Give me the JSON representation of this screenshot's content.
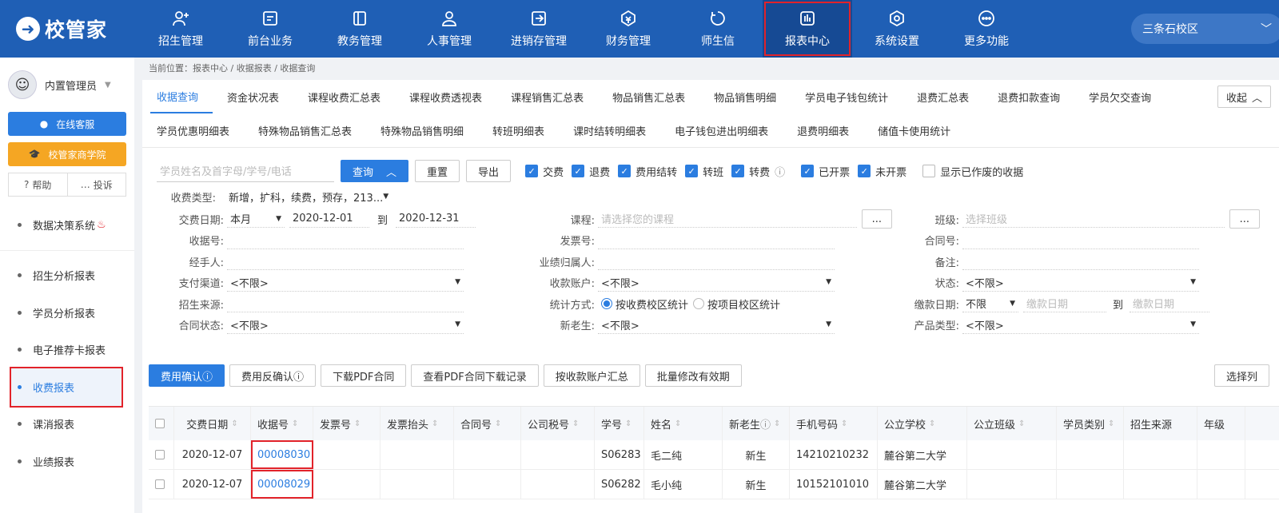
{
  "app": {
    "logo_text": "校管家"
  },
  "nav": [
    {
      "label": "招生管理",
      "icon": "user-plus-icon"
    },
    {
      "label": "前台业务",
      "icon": "desk-icon"
    },
    {
      "label": "教务管理",
      "icon": "book-icon"
    },
    {
      "label": "人事管理",
      "icon": "person-icon"
    },
    {
      "label": "进销存管理",
      "icon": "inventory-icon"
    },
    {
      "label": "财务管理",
      "icon": "money-icon"
    },
    {
      "label": "师生信",
      "icon": "chat-icon"
    },
    {
      "label": "报表中心",
      "icon": "report-icon"
    },
    {
      "label": "系统设置",
      "icon": "settings-icon"
    },
    {
      "label": "更多功能",
      "icon": "more-icon"
    }
  ],
  "campus": "三条石校区",
  "sidebar": {
    "user": "内置管理员",
    "online_service": "在线客服",
    "academy": "校管家商学院",
    "help": "帮助",
    "complaint": "投诉",
    "items": [
      {
        "label": "数据决策系统"
      },
      {
        "label": "招生分析报表"
      },
      {
        "label": "学员分析报表"
      },
      {
        "label": "电子推荐卡报表"
      },
      {
        "label": "收费报表"
      },
      {
        "label": "课消报表"
      },
      {
        "label": "业绩报表"
      }
    ]
  },
  "breadcrumb": "当前位置：报表中心 / 收据报表 / 收据查询",
  "tabs_row1": [
    "收据查询",
    "资金状况表",
    "课程收费汇总表",
    "课程收费透视表",
    "课程销售汇总表",
    "物品销售汇总表",
    "物品销售明细",
    "学员电子钱包统计",
    "退费汇总表",
    "退费扣款查询",
    "学员欠交查询"
  ],
  "tabs_row2": [
    "学员优惠明细表",
    "特殊物品销售汇总表",
    "特殊物品销售明细",
    "转班明细表",
    "课时结转明细表",
    "电子钱包进出明细表",
    "退费明细表",
    "储值卡使用统计"
  ],
  "collapse_label": "收起",
  "search": {
    "placeholder": "学员姓名及首字母/学号/电话",
    "query": "查询",
    "reset": "重置",
    "export": "导出"
  },
  "checkboxes": [
    {
      "label": "交费",
      "checked": true
    },
    {
      "label": "退费",
      "checked": true
    },
    {
      "label": "费用结转",
      "checked": true
    },
    {
      "label": "转班",
      "checked": true
    },
    {
      "label": "转费",
      "checked": true
    },
    {
      "label": "已开票",
      "checked": true
    },
    {
      "label": "未开票",
      "checked": true
    },
    {
      "label": "显示已作废的收据",
      "checked": false
    }
  ],
  "fee_type": {
    "label": "收费类型:",
    "value": "新增，扩科，续费，预存，213..."
  },
  "filters": {
    "date_label": "交费日期:",
    "date_mode": "本月",
    "date_from": "2020-12-01",
    "date_to_label": "到",
    "date_to": "2020-12-31",
    "course_label": "课程:",
    "course_ph": "请选择您的课程",
    "class_label": "班级:",
    "class_ph": "选择班级",
    "receipt_label": "收据号:",
    "invoice_label": "发票号:",
    "contract_label": "合同号:",
    "handler_label": "经手人:",
    "perf_label": "业绩归属人:",
    "remark_label": "备注:",
    "pay_channel_label": "支付渠道:",
    "pay_channel": "<不限>",
    "account_label": "收款账户:",
    "account": "<不限>",
    "status_label": "状态:",
    "status": "<不限>",
    "source_label": "招生来源:",
    "stat_label": "统计方式:",
    "stat_opt1": "按收费校区统计",
    "stat_opt2": "按项目校区统计",
    "paydate_label": "缴款日期:",
    "paydate_mode": "不限",
    "paydate_ph": "缴款日期",
    "paydate_to": "到",
    "contract_status_label": "合同状态:",
    "contract_status": "<不限>",
    "newold_label": "新老生:",
    "newold": "<不限>",
    "product_label": "产品类型:",
    "product": "<不限>",
    "more": "..."
  },
  "actions": [
    "费用确认",
    "费用反确认",
    "下载PDF合同",
    "查看PDF合同下载记录",
    "按收款账户汇总",
    "批量修改有效期"
  ],
  "select_columns": "选择列",
  "table": {
    "headers": [
      "交费日期",
      "收据号",
      "发票号",
      "发票抬头",
      "合同号",
      "公司税号",
      "学号",
      "姓名",
      "新老生",
      "手机号码",
      "公立学校",
      "公立班级",
      "学员类别",
      "招生来源",
      "年级"
    ],
    "rows": [
      [
        "2020-12-07",
        "00008030",
        "",
        "",
        "",
        "",
        "S06283",
        "毛二纯",
        "新生",
        "14210210232",
        "麓谷第二大学",
        "",
        "",
        "",
        ""
      ],
      [
        "2020-12-07",
        "00008029",
        "",
        "",
        "",
        "",
        "S06282",
        "毛小纯",
        "新生",
        "10152101010",
        "麓谷第二大学",
        "",
        "",
        "",
        ""
      ]
    ]
  },
  "colors": {
    "primary": "#2b7de0",
    "topbar": "#1f5fb5",
    "highlight": "#e2232a",
    "academy": "#f5a623"
  }
}
